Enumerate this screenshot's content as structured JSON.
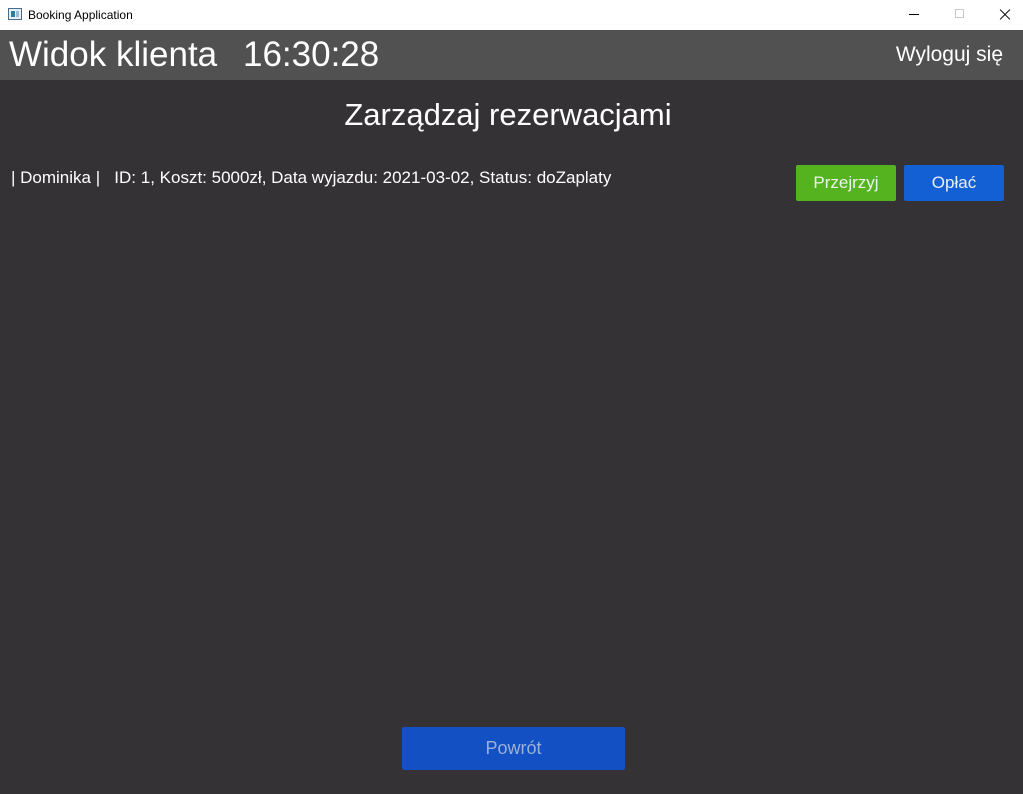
{
  "window": {
    "title": "Booking Application"
  },
  "header": {
    "view_title": "Widok klienta",
    "clock": "16:30:28",
    "logout_label": "Wyloguj się"
  },
  "main": {
    "title": "Zarządzaj rezerwacjami",
    "reservations": [
      {
        "text": "| Dominika |   ID: 1, Koszt: 5000zł, Data wyjazdu: 2021-03-02, Status: doZaplaty",
        "view_label": "Przejrzyj",
        "pay_label": "Opłać"
      }
    ],
    "back_label": "Powrót"
  },
  "colors": {
    "header_bg": "#525152",
    "content_bg": "#343235",
    "view_button": "#54b31f",
    "pay_button": "#1360d4",
    "back_button": "#1350c4"
  }
}
